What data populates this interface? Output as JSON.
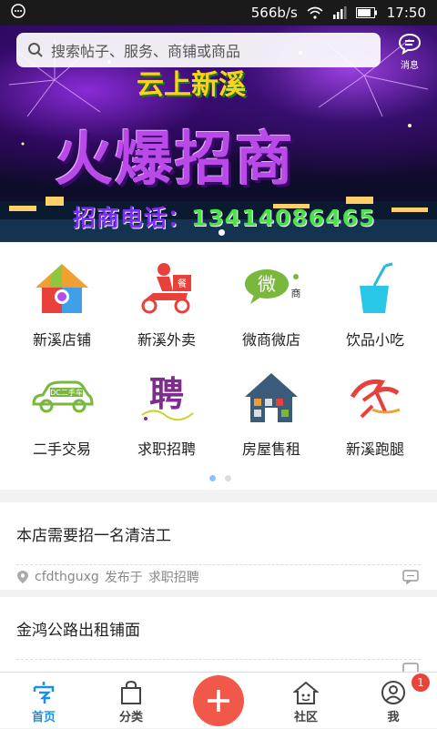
{
  "status_bar": {
    "speed": "566b/s",
    "time": "17:50"
  },
  "search": {
    "placeholder": "搜索帖子、服务、商铺或商品"
  },
  "message": {
    "label": "消息"
  },
  "banner": {
    "top_text": "云上新溪",
    "headline": "火爆招商",
    "phone_label": "招商电话：",
    "phone_number": "13414086465"
  },
  "categories": [
    {
      "label": "新溪店铺",
      "icon": "puzzle-house-icon"
    },
    {
      "label": "新溪外卖",
      "icon": "delivery-scooter-icon"
    },
    {
      "label": "微商微店",
      "icon": "wechat-shop-icon"
    },
    {
      "label": "饮品小吃",
      "icon": "drink-cup-icon"
    },
    {
      "label": "二手交易",
      "icon": "second-hand-car-icon"
    },
    {
      "label": "求职招聘",
      "icon": "recruit-icon"
    },
    {
      "label": "房屋售租",
      "icon": "house-icon"
    },
    {
      "label": "新溪跑腿",
      "icon": "errand-runner-icon"
    }
  ],
  "pager": {
    "pages": 2,
    "current": 1
  },
  "posts": [
    {
      "title": "本店需要招一名清洁工",
      "author": "cfdthguxg",
      "published_in": "发布于",
      "category": "求职招聘"
    },
    {
      "title": "金鸿公路出租铺面"
    }
  ],
  "tabs": [
    {
      "label": "首页",
      "icon": "home-icon"
    },
    {
      "label": "分类",
      "icon": "bag-icon"
    },
    {
      "label": "社区",
      "icon": "community-icon"
    },
    {
      "label": "我",
      "icon": "user-icon"
    }
  ],
  "badge": {
    "count": "1"
  },
  "colors": {
    "accent": "#1e8ee0",
    "fab": "#f2584a",
    "badge": "#e8443a"
  }
}
